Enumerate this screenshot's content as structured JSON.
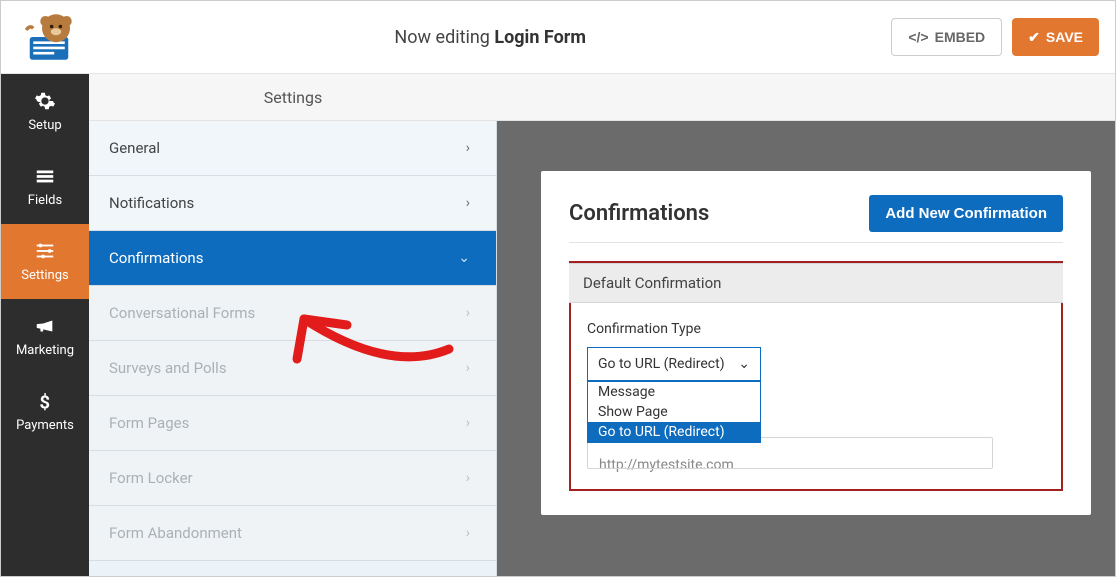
{
  "header": {
    "editing_prefix": "Now editing",
    "form_name": "Login Form",
    "embed_label": "EMBED",
    "save_label": "SAVE"
  },
  "rail": {
    "items": [
      {
        "label": "Setup"
      },
      {
        "label": "Fields"
      },
      {
        "label": "Settings"
      },
      {
        "label": "Marketing"
      },
      {
        "label": "Payments"
      }
    ]
  },
  "settings_bar": {
    "title": "Settings"
  },
  "submenu": {
    "items": [
      {
        "label": "General"
      },
      {
        "label": "Notifications"
      },
      {
        "label": "Confirmations"
      },
      {
        "label": "Conversational Forms"
      },
      {
        "label": "Surveys and Polls"
      },
      {
        "label": "Form Pages"
      },
      {
        "label": "Form Locker"
      },
      {
        "label": "Form Abandonment"
      }
    ]
  },
  "panel": {
    "title": "Confirmations",
    "add_button": "Add New Confirmation",
    "default_label": "Default Confirmation",
    "field_label": "Confirmation Type",
    "select_value": "Go to URL (Redirect)",
    "options": [
      {
        "label": "Message"
      },
      {
        "label": "Show Page"
      },
      {
        "label": "Go to URL (Redirect)"
      }
    ],
    "url_placeholder": "http://mytestsite.com"
  }
}
